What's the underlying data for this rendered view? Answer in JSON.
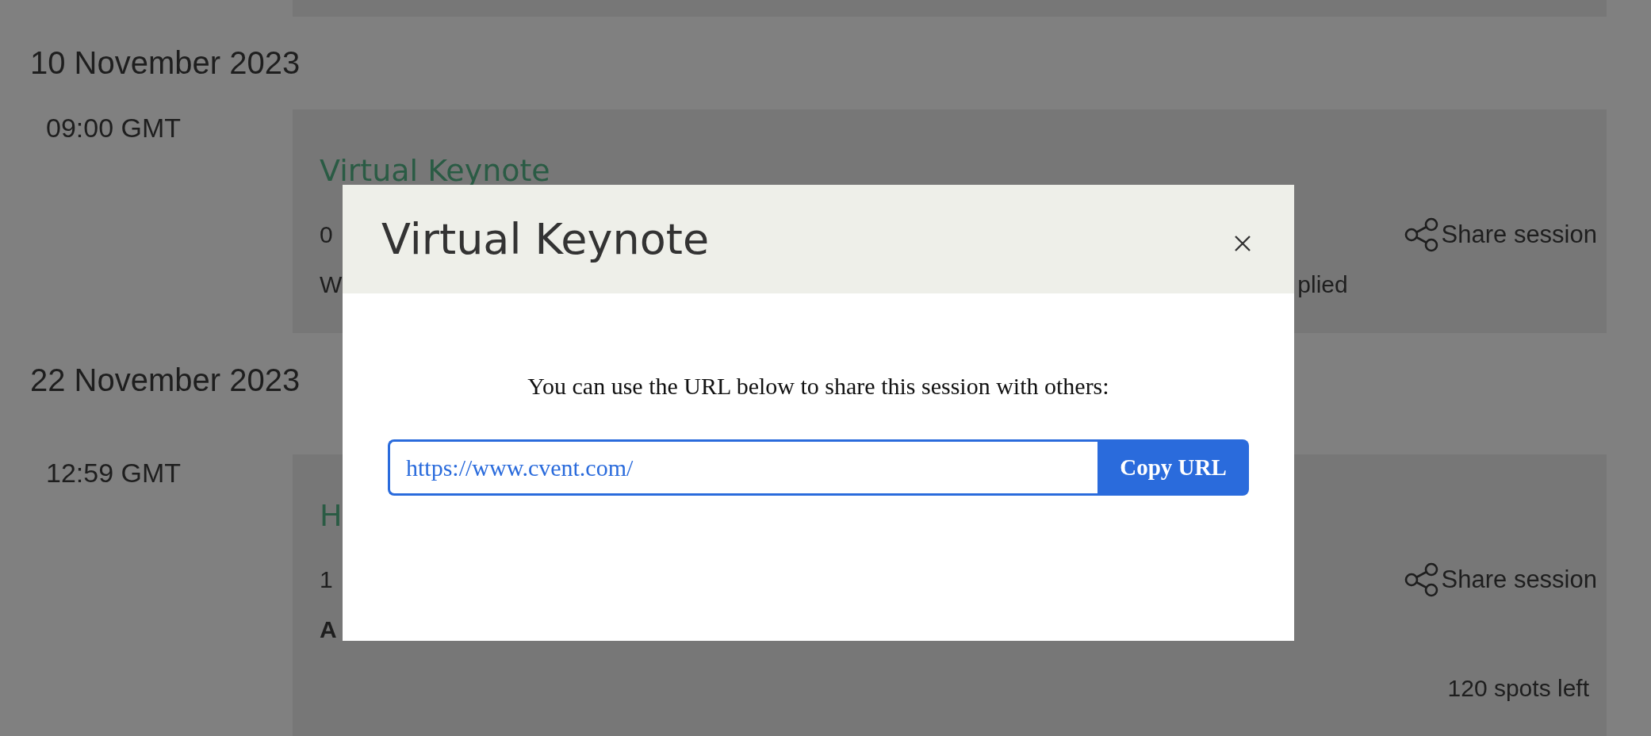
{
  "days": [
    {
      "date": "10 November 2023",
      "sessions": [
        {
          "time": "09:00 GMT",
          "title": "Virtual Keynote",
          "line_1": "0",
          "line_2_start": "W",
          "line_2_end": "plied",
          "line_2_bold": false,
          "share": "Share session"
        }
      ]
    },
    {
      "date": "22 November 2023",
      "sessions": [
        {
          "time": "12:59 GMT",
          "title": "H",
          "line_1": "1",
          "line_2_start": "A",
          "line_2_bold": true,
          "share": "Share session",
          "spots": "120 spots left"
        }
      ]
    }
  ],
  "modal": {
    "title": "Virtual Keynote",
    "message": "You can use the URL below to share this session with others:",
    "url": "https://www.cvent.com/",
    "button": "Copy URL"
  }
}
